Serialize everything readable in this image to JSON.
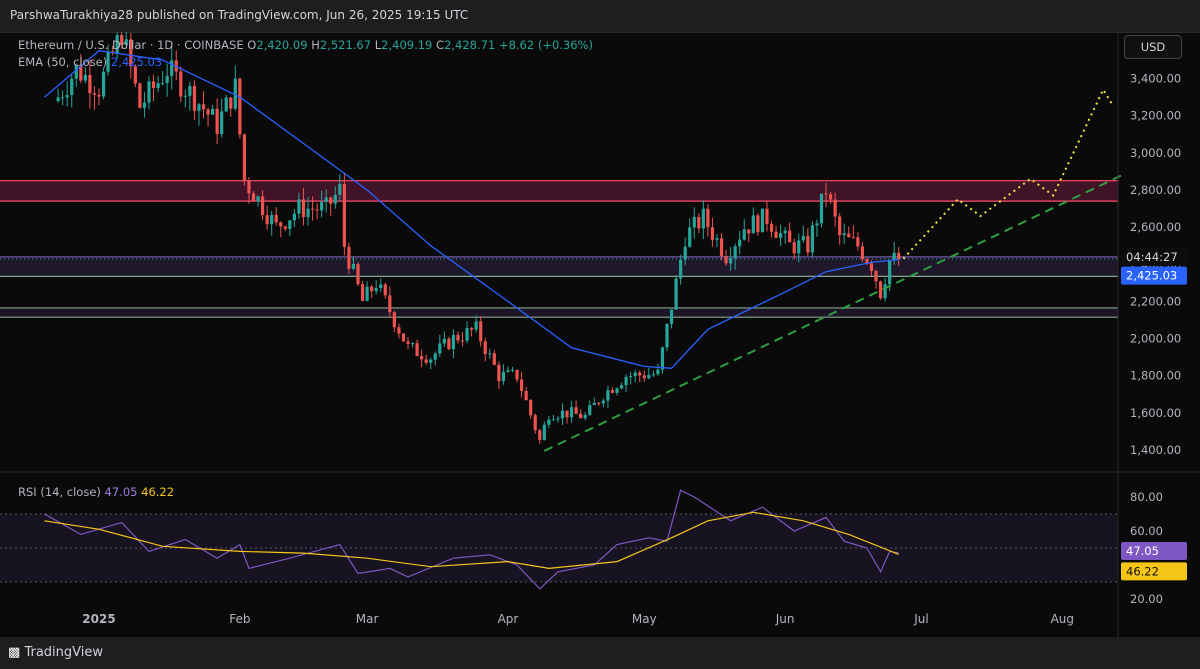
{
  "header": {
    "publisher": "ParshwaTurakhiya28 published on TradingView.com, Jun 26, 2025 19:15 UTC"
  },
  "footer": {
    "brand": "TradingView"
  },
  "legend": {
    "symbol": "Ethereum / U.S. Dollar · 1D · COINBASE",
    "o_label": "O",
    "o_value": "2,420.09",
    "h_label": "H",
    "h_value": "2,521.67",
    "l_label": "L",
    "l_value": "2,409.19",
    "c_label": "C",
    "c_value": "2,428.71",
    "change": "+8.62 (+0.36%)",
    "ema_label": "EMA (50, close)",
    "ema_value": "2,425.03",
    "rsi_label": "RSI (14, close)",
    "rsi_value": "47.05",
    "rsi_ma_value": "46.22"
  },
  "currency_button": "USD",
  "price_tags": {
    "countdown": "04:44:27",
    "ema": "2,425.03",
    "rsi": "47.05",
    "rsi_ma": "46.22"
  },
  "colors": {
    "up": "#26a69a",
    "down": "#ef5350",
    "ema": "#2962ff",
    "rsi": "#7e57c2",
    "rsi_ma": "#f5c518",
    "zone": "#ff4d6d",
    "support": "#a5d6a7",
    "projection": "#f0e442",
    "trendline": "#2e9e40"
  },
  "chart_data": [
    {
      "type": "candlestick",
      "title": "Ethereum / U.S. Dollar · 1D · COINBASE",
      "y_axis": {
        "ticks": [
          1400,
          1600,
          1800,
          2000,
          2200,
          2400,
          2600,
          2800,
          3000,
          3200,
          3400
        ],
        "tick_labels": [
          "1,400.00",
          "1,600.00",
          "1,800.00",
          "2,000.00",
          "2,200.00",
          "2,400.00",
          "2,600.00",
          "2,800.00",
          "3,000.00",
          "3,200.00",
          "3,400.00"
        ],
        "range": [
          1260,
          3720
        ]
      },
      "x_axis": {
        "labels": [
          "2025",
          "Feb",
          "Mar",
          "Apr",
          "May",
          "Jun",
          "Jul",
          "Aug"
        ],
        "dates": [
          "2025-01-01",
          "2025-02-01",
          "2025-03-01",
          "2025-04-01",
          "2025-05-01",
          "2025-06-01",
          "2025-07-01",
          "2025-08-01"
        ]
      },
      "grid": false,
      "key_closes": [
        {
          "date": "2024-12-23",
          "close": 3300
        },
        {
          "date": "2024-12-27",
          "close": 3450
        },
        {
          "date": "2025-01-01",
          "close": 3350
        },
        {
          "date": "2025-01-06",
          "close": 3650
        },
        {
          "date": "2025-01-10",
          "close": 3250
        },
        {
          "date": "2025-01-16",
          "close": 3450
        },
        {
          "date": "2025-01-22",
          "close": 3300
        },
        {
          "date": "2025-01-27",
          "close": 3150
        },
        {
          "date": "2025-01-31",
          "close": 3350
        },
        {
          "date": "2025-02-02",
          "close": 2850
        },
        {
          "date": "2025-02-05",
          "close": 2750
        },
        {
          "date": "2025-02-09",
          "close": 2600
        },
        {
          "date": "2025-02-14",
          "close": 2700
        },
        {
          "date": "2025-02-20",
          "close": 2700
        },
        {
          "date": "2025-02-23",
          "close": 2800
        },
        {
          "date": "2025-02-24",
          "close": 2500
        },
        {
          "date": "2025-02-28",
          "close": 2200
        },
        {
          "date": "2025-03-03",
          "close": 2300
        },
        {
          "date": "2025-03-06",
          "close": 2150
        },
        {
          "date": "2025-03-10",
          "close": 1950
        },
        {
          "date": "2025-03-15",
          "close": 1900
        },
        {
          "date": "2025-03-20",
          "close": 2000
        },
        {
          "date": "2025-03-25",
          "close": 2050
        },
        {
          "date": "2025-03-30",
          "close": 1800
        },
        {
          "date": "2025-04-03",
          "close": 1800
        },
        {
          "date": "2025-04-08",
          "close": 1450
        },
        {
          "date": "2025-04-10",
          "close": 1600
        },
        {
          "date": "2025-04-14",
          "close": 1600
        },
        {
          "date": "2025-04-18",
          "close": 1580
        },
        {
          "date": "2025-04-22",
          "close": 1700
        },
        {
          "date": "2025-04-27",
          "close": 1800
        },
        {
          "date": "2025-05-04",
          "close": 1810
        },
        {
          "date": "2025-05-08",
          "close": 2300
        },
        {
          "date": "2025-05-10",
          "close": 2550
        },
        {
          "date": "2025-05-14",
          "close": 2650
        },
        {
          "date": "2025-05-19",
          "close": 2450
        },
        {
          "date": "2025-05-23",
          "close": 2600
        },
        {
          "date": "2025-05-28",
          "close": 2650
        },
        {
          "date": "2025-06-02",
          "close": 2500
        },
        {
          "date": "2025-06-06",
          "close": 2500
        },
        {
          "date": "2025-06-10",
          "close": 2800
        },
        {
          "date": "2025-06-13",
          "close": 2550
        },
        {
          "date": "2025-06-17",
          "close": 2500
        },
        {
          "date": "2025-06-20",
          "close": 2400
        },
        {
          "date": "2025-06-22",
          "close": 2250
        },
        {
          "date": "2025-06-24",
          "close": 2420
        },
        {
          "date": "2025-06-26",
          "close": 2428.71
        }
      ],
      "ema50": [
        {
          "date": "2024-12-20",
          "value": 3300
        },
        {
          "date": "2025-01-01",
          "value": 3550
        },
        {
          "date": "2025-01-15",
          "value": 3500
        },
        {
          "date": "2025-02-01",
          "value": 3300
        },
        {
          "date": "2025-02-15",
          "value": 3050
        },
        {
          "date": "2025-03-01",
          "value": 2800
        },
        {
          "date": "2025-03-15",
          "value": 2500
        },
        {
          "date": "2025-04-01",
          "value": 2200
        },
        {
          "date": "2025-04-15",
          "value": 1950
        },
        {
          "date": "2025-05-01",
          "value": 1850
        },
        {
          "date": "2025-05-07",
          "value": 1840
        },
        {
          "date": "2025-05-15",
          "value": 2050
        },
        {
          "date": "2025-06-01",
          "value": 2250
        },
        {
          "date": "2025-06-10",
          "value": 2360
        },
        {
          "date": "2025-06-20",
          "value": 2410
        },
        {
          "date": "2025-06-26",
          "value": 2425.03
        }
      ],
      "resistance_zone": [
        2740,
        2850
      ],
      "support_lines": [
        2440,
        2335,
        2165,
        2115
      ],
      "trendline": [
        {
          "date": "2025-04-09",
          "value": 1395
        },
        {
          "date": "2025-08-15",
          "value": 2890
        }
      ],
      "projection": [
        {
          "date": "2025-06-27",
          "value": 2430
        },
        {
          "date": "2025-07-09",
          "value": 2750
        },
        {
          "date": "2025-07-14",
          "value": 2660
        },
        {
          "date": "2025-07-25",
          "value": 2860
        },
        {
          "date": "2025-07-30",
          "value": 2770
        },
        {
          "date": "2025-08-10",
          "value": 3340
        },
        {
          "date": "2025-08-12",
          "value": 3260
        }
      ]
    },
    {
      "type": "line",
      "title": "RSI (14, close)",
      "y_axis": {
        "ticks": [
          20,
          40,
          60,
          80
        ],
        "tick_labels": [
          "20.00",
          "",
          "60.00",
          "80.00"
        ],
        "range": [
          15,
          90
        ]
      },
      "bands": [
        30,
        50,
        70
      ],
      "series": [
        {
          "name": "RSI",
          "points": [
            {
              "date": "2024-12-20",
              "value": 70
            },
            {
              "date": "2024-12-28",
              "value": 58
            },
            {
              "date": "2025-01-06",
              "value": 65
            },
            {
              "date": "2025-01-12",
              "value": 48
            },
            {
              "date": "2025-01-20",
              "value": 55
            },
            {
              "date": "2025-01-27",
              "value": 44
            },
            {
              "date": "2025-02-01",
              "value": 52
            },
            {
              "date": "2025-02-03",
              "value": 38
            },
            {
              "date": "2025-02-12",
              "value": 44
            },
            {
              "date": "2025-02-23",
              "value": 52
            },
            {
              "date": "2025-02-27",
              "value": 35
            },
            {
              "date": "2025-03-06",
              "value": 38
            },
            {
              "date": "2025-03-10",
              "value": 33
            },
            {
              "date": "2025-03-20",
              "value": 44
            },
            {
              "date": "2025-03-28",
              "value": 46
            },
            {
              "date": "2025-04-03",
              "value": 40
            },
            {
              "date": "2025-04-08",
              "value": 26
            },
            {
              "date": "2025-04-12",
              "value": 36
            },
            {
              "date": "2025-04-20",
              "value": 40
            },
            {
              "date": "2025-04-25",
              "value": 52
            },
            {
              "date": "2025-05-02",
              "value": 56
            },
            {
              "date": "2025-05-06",
              "value": 54
            },
            {
              "date": "2025-05-09",
              "value": 84
            },
            {
              "date": "2025-05-12",
              "value": 80
            },
            {
              "date": "2025-05-20",
              "value": 66
            },
            {
              "date": "2025-05-27",
              "value": 74
            },
            {
              "date": "2025-06-03",
              "value": 60
            },
            {
              "date": "2025-06-10",
              "value": 68
            },
            {
              "date": "2025-06-14",
              "value": 54
            },
            {
              "date": "2025-06-19",
              "value": 50
            },
            {
              "date": "2025-06-22",
              "value": 36
            },
            {
              "date": "2025-06-24",
              "value": 48
            },
            {
              "date": "2025-06-26",
              "value": 47.05
            }
          ]
        },
        {
          "name": "RSI MA",
          "points": [
            {
              "date": "2024-12-20",
              "value": 66
            },
            {
              "date": "2025-01-01",
              "value": 61
            },
            {
              "date": "2025-01-15",
              "value": 51
            },
            {
              "date": "2025-02-01",
              "value": 48
            },
            {
              "date": "2025-02-15",
              "value": 47
            },
            {
              "date": "2025-03-01",
              "value": 44
            },
            {
              "date": "2025-03-15",
              "value": 39
            },
            {
              "date": "2025-04-01",
              "value": 42
            },
            {
              "date": "2025-04-10",
              "value": 38
            },
            {
              "date": "2025-04-25",
              "value": 42
            },
            {
              "date": "2025-05-07",
              "value": 56
            },
            {
              "date": "2025-05-15",
              "value": 66
            },
            {
              "date": "2025-05-25",
              "value": 71
            },
            {
              "date": "2025-06-05",
              "value": 66
            },
            {
              "date": "2025-06-15",
              "value": 58
            },
            {
              "date": "2025-06-26",
              "value": 46.22
            }
          ]
        }
      ]
    }
  ]
}
